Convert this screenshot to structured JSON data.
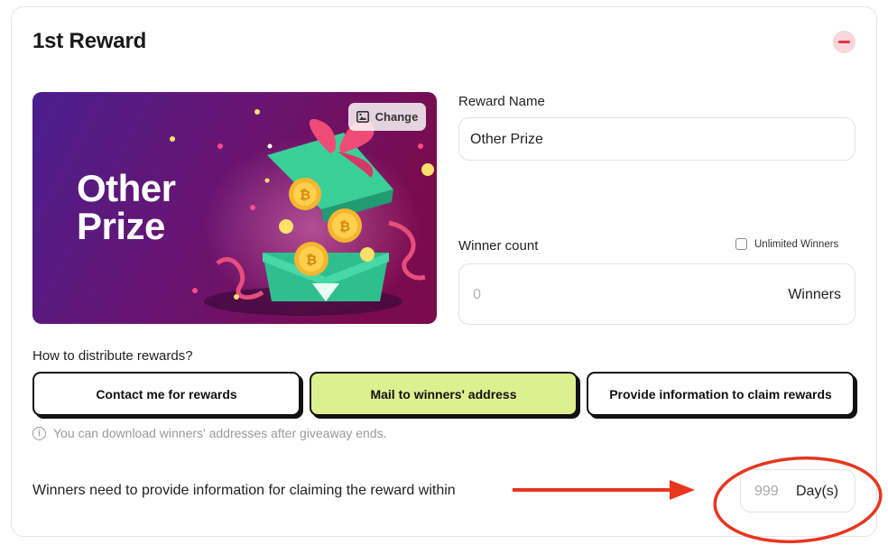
{
  "reward": {
    "title": "1st Reward",
    "banner": {
      "text_line1": "Other",
      "text_line2": "Prize",
      "change_label": "Change",
      "bg_start": "#4a1f8e",
      "bg_end": "#7a0c4e"
    },
    "reward_name": {
      "label": "Reward Name",
      "value": "Other Prize"
    },
    "winner_count": {
      "label": "Winner count",
      "unlimited_label": "Unlimited Winners",
      "placeholder": "0",
      "unit": "Winners"
    },
    "distribution": {
      "question": "How to distribute rewards?",
      "options": [
        {
          "label": "Contact me for rewards",
          "selected": false
        },
        {
          "label": "Mail to winners' address",
          "selected": true
        },
        {
          "label": "Provide information to claim rewards",
          "selected": false
        }
      ],
      "hint": "You can download winners' addresses after giveaway ends."
    },
    "claim": {
      "text": "Winners need to provide information for claiming the reward within",
      "placeholder": "999",
      "unit": "Day(s)"
    }
  },
  "colors": {
    "accent_selected": "#deef8f",
    "remove_bg": "#f9d6d9",
    "remove_icon": "#e0344b",
    "annotation_red": "#e8361f"
  }
}
